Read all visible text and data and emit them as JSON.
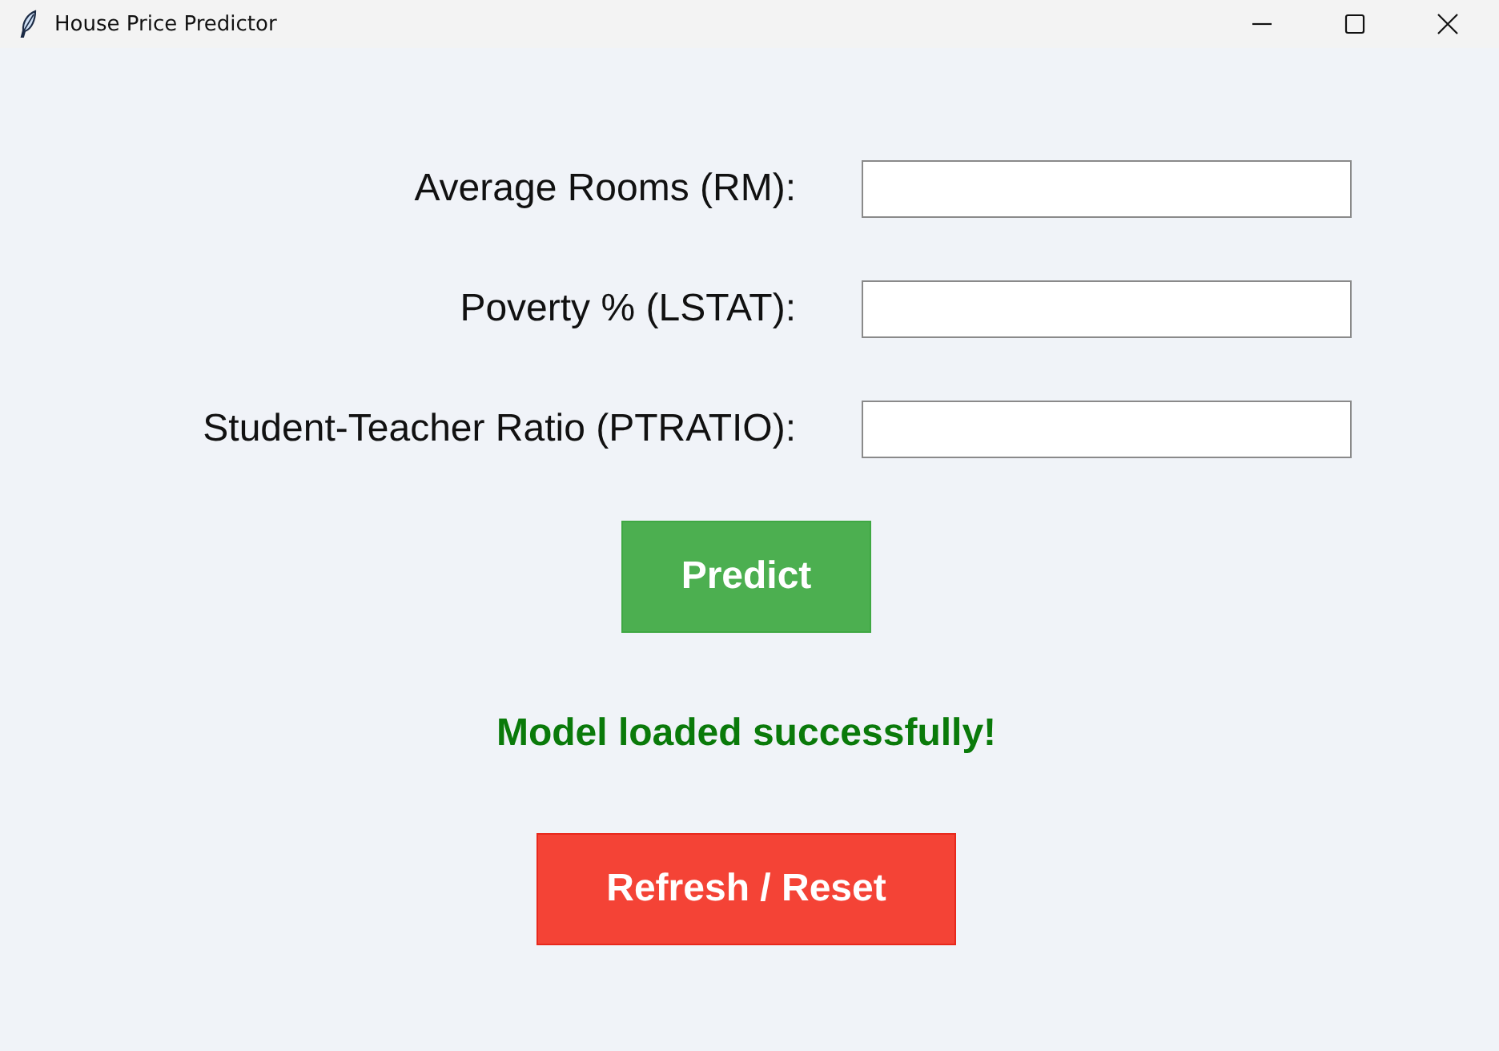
{
  "window": {
    "title": "House Price Predictor"
  },
  "fields": [
    {
      "label": "Average Rooms (RM):"
    },
    {
      "label": "Poverty % (LSTAT):"
    },
    {
      "label": "Student-Teacher Ratio (PTRATIO):"
    }
  ],
  "predict_button": {
    "label": "Predict"
  },
  "status": {
    "kind": "success",
    "text": "Model loaded successfully!"
  },
  "reset_button": {
    "label": "Refresh / Reset"
  }
}
